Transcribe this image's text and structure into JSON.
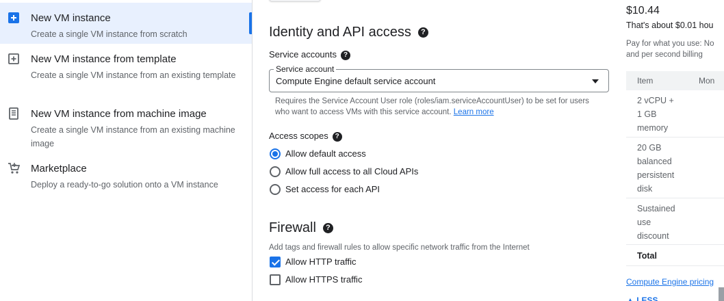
{
  "left_nav": {
    "items": [
      {
        "icon": "add-box-icon",
        "title": "New VM instance",
        "desc": "Create a single VM instance from scratch",
        "selected": true
      },
      {
        "icon": "template-icon",
        "title": "New VM instance from template",
        "desc": "Create a single VM instance from an existing template",
        "selected": false
      },
      {
        "icon": "machine-image-icon",
        "title": "New VM instance from machine image",
        "desc": "Create a single VM instance from an existing machine image",
        "selected": false
      },
      {
        "icon": "marketplace-cart-icon",
        "title": "Marketplace",
        "desc": "Deploy a ready-to-go solution onto a VM instance",
        "selected": false
      }
    ]
  },
  "identity": {
    "title": "Identity and API access",
    "service_accounts_label": "Service accounts",
    "service_account_legend": "Service account",
    "service_account_value": "Compute Engine default service account",
    "hint": "Requires the Service Account User role (roles/iam.serviceAccountUser) to be set for users who want to access VMs with this service account.",
    "learn_more": "Learn more",
    "access_scopes_label": "Access scopes",
    "scopes": [
      {
        "label": "Allow default access",
        "checked": true
      },
      {
        "label": "Allow full access to all Cloud APIs",
        "checked": false
      },
      {
        "label": "Set access for each API",
        "checked": false
      }
    ]
  },
  "firewall": {
    "title": "Firewall",
    "desc": "Add tags and firewall rules to allow specific network traffic from the Internet",
    "options": [
      {
        "label": "Allow HTTP traffic",
        "checked": true
      },
      {
        "label": "Allow HTTPS traffic",
        "checked": false
      }
    ]
  },
  "pricing": {
    "price": "$10.44",
    "about": "That's about $0.01 hou",
    "pay_line1": "Pay for what you use: No",
    "pay_line2": "and per second billing",
    "headers": [
      "Item",
      "Mon"
    ],
    "rows": [
      [
        "2 vCPU +",
        "1 GB",
        "memory"
      ],
      [
        "20 GB",
        "balanced",
        "persistent",
        "disk"
      ],
      [
        "Sustained",
        "use",
        "discount"
      ],
      [
        "Total"
      ]
    ],
    "link": "Compute Engine pricing",
    "less": "LESS"
  },
  "colors": {
    "accent": "#1a73e8",
    "selected_bg": "#e8f0fe"
  }
}
